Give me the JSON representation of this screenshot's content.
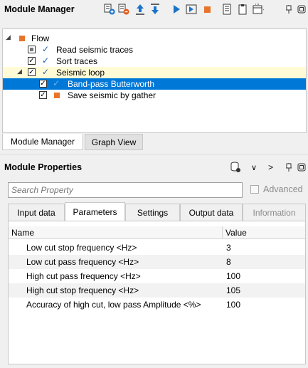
{
  "module_manager": {
    "title": "Module Manager",
    "toolbar_icons": [
      "add-module-icon",
      "remove-module-icon",
      "move-up-icon",
      "move-down-icon",
      "run-icon",
      "run-step-icon",
      "stop-icon",
      "document-icon",
      "clipboard-icon",
      "window-layout-icon",
      "pin-icon",
      "restore-icon"
    ]
  },
  "tree": {
    "items": [
      {
        "label": "Flow"
      },
      {
        "label": "Read seismic traces"
      },
      {
        "label": "Sort traces"
      },
      {
        "label": "Seismic loop"
      },
      {
        "label": "Band-pass Butterworth"
      },
      {
        "label": "Save seismic by gather"
      }
    ],
    "colors": {
      "selected_bg": "#0078d7",
      "highlight_bg": "#fffbd6",
      "orange": "#e8742b"
    }
  },
  "bottom_tabs": [
    {
      "label": "Module Manager"
    },
    {
      "label": "Graph View"
    }
  ],
  "module_properties": {
    "title": "Module Properties",
    "search_placeholder": "Search Property",
    "advanced_label": "Advanced",
    "tabs": [
      {
        "label": "Input data"
      },
      {
        "label": "Parameters"
      },
      {
        "label": "Settings"
      },
      {
        "label": "Output data"
      },
      {
        "label": "Information"
      }
    ],
    "active_tab": "Parameters",
    "grid": {
      "columns": [
        "Name",
        "Value"
      ],
      "rows": [
        {
          "name": "Low cut stop frequency <Hz>",
          "value": "3"
        },
        {
          "name": "Low cut pass frequency <Hz>",
          "value": "8"
        },
        {
          "name": "High cut pass frequency <Hz>",
          "value": "100"
        },
        {
          "name": "High cut stop frequency <Hz>",
          "value": "105"
        },
        {
          "name": "Accuracy of high cut, low pass Amplitude <%>",
          "value": "100"
        }
      ]
    }
  }
}
